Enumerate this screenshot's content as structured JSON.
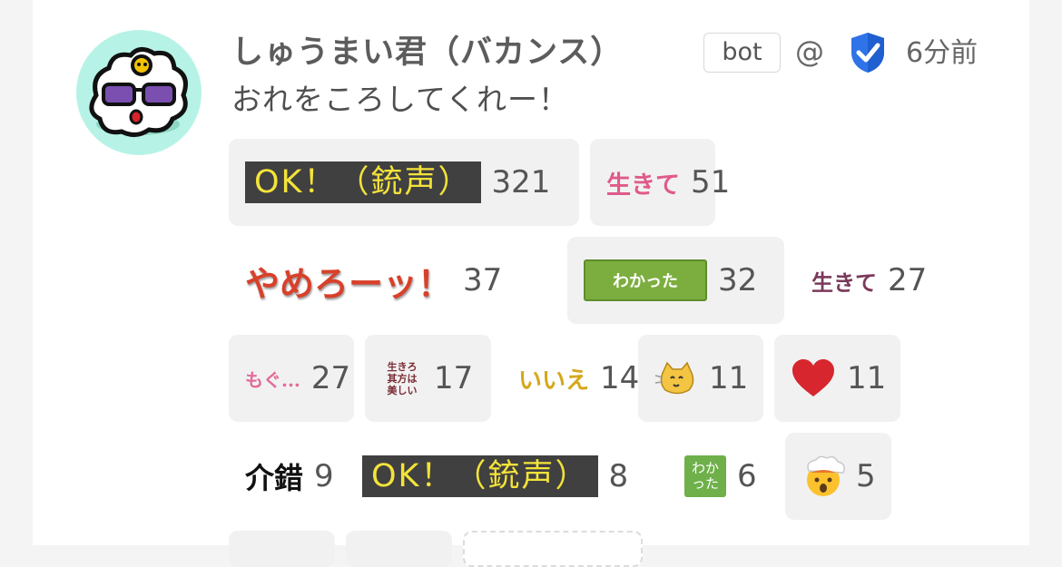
{
  "note": {
    "user_name": "しゅうまい君（バカンス）",
    "bot_label": "bot",
    "at_symbol": "@",
    "time": "6分前",
    "text": "おれをころしてくれー！"
  },
  "reactions": [
    {
      "emoji_text": "OK！（銃声）",
      "count": "321"
    },
    {
      "emoji_text": "生きて",
      "count": "51"
    },
    {
      "emoji_text": "やめろーッ！",
      "count": "37"
    },
    {
      "emoji_text": "わかった",
      "count": "32"
    },
    {
      "emoji_text": "生きて",
      "count": "27"
    },
    {
      "emoji_text": "もぐ...",
      "count": "27"
    },
    {
      "emoji_text": "生きろ 其方は 美しい",
      "count": "17"
    },
    {
      "emoji_text": "いいえ",
      "count": "14"
    },
    {
      "icon": "cat-emoji-icon",
      "count": "11"
    },
    {
      "icon": "heart-emoji-icon",
      "count": "11"
    },
    {
      "emoji_text": "介錯",
      "count": "9"
    },
    {
      "emoji_text": "OK！（銃声）",
      "count": "8"
    },
    {
      "emoji_text": "わか った",
      "count": "6"
    },
    {
      "icon": "exploding-head-emoji-icon",
      "count": "5"
    }
  ],
  "colors": {
    "avatar_bg": "#b6f3e6",
    "verified_blue": "#2f73e8",
    "green_emoji": "#7cae3f",
    "ok_emoji_bg": "#404040",
    "ok_emoji_text": "#f3e33a"
  }
}
